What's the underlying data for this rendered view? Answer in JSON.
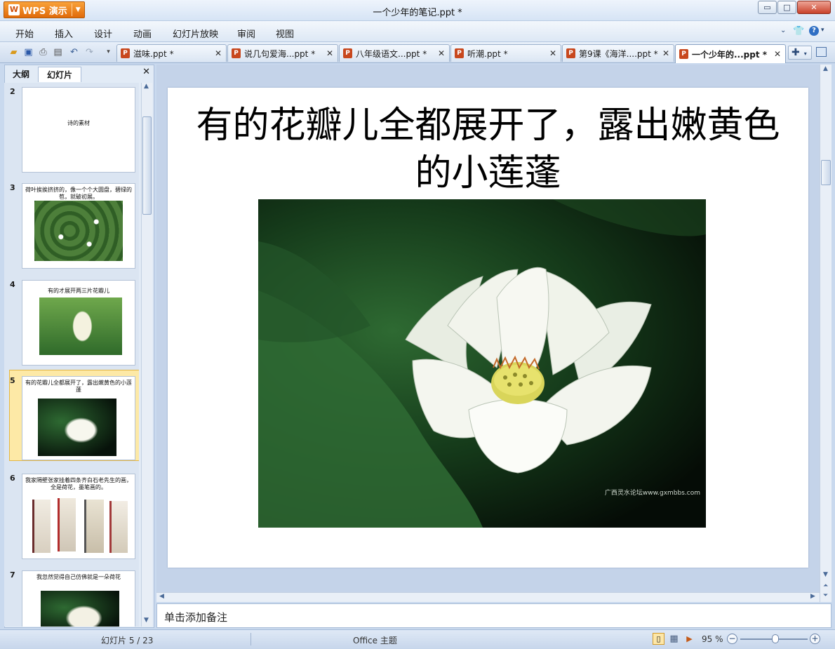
{
  "app": {
    "name": "WPS 演示",
    "window_title": "一个少年的笔记.ppt *"
  },
  "window_controls": {
    "minimize": "▭",
    "maximize": "□",
    "close": "✕"
  },
  "menu": [
    "开始",
    "插入",
    "设计",
    "动画",
    "幻灯片放映",
    "审阅",
    "视图"
  ],
  "doc_tabs": [
    {
      "label": "滋味.ppt *",
      "active": false
    },
    {
      "label": "说几句爱海...ppt *",
      "active": false
    },
    {
      "label": "八年级语文...ppt *",
      "active": false
    },
    {
      "label": "听潮.ppt *",
      "active": false
    },
    {
      "label": "第9课《海洋....ppt *",
      "active": false
    },
    {
      "label": "一个少年的...ppt *",
      "active": true
    }
  ],
  "left_panel": {
    "tabs": [
      "大纲",
      "幻灯片"
    ],
    "active_tab": "幻灯片"
  },
  "thumbnails": [
    {
      "num": "2",
      "text": "诗的素材"
    },
    {
      "num": "3",
      "text": "荷叶挨挨挤挤的，像一个个大圆盘，碧绿的苞，就破初展。"
    },
    {
      "num": "4",
      "text": "有的才展开两三片花瓣儿"
    },
    {
      "num": "5",
      "text": "有的花瓣儿全都展开了，露出嫩黄色的小莲蓬"
    },
    {
      "num": "6",
      "text": "我家隔壁张家挂着四条齐白石老先生的画，全是荷花，墨笔画的。"
    },
    {
      "num": "7",
      "text": "我忽然觉得自己仿佛就是一朵荷花"
    }
  ],
  "slide": {
    "title": "有的花瓣儿全都展开了，露出嫩黄色的小莲蓬",
    "watermark": "广西灵水论坛www.gxmbbs.com"
  },
  "notes_placeholder": "单击添加备注",
  "status": {
    "slide_pos": "幻灯片 5 / 23",
    "theme": "Office 主题",
    "zoom": "95 %",
    "zoom_fraction": 0.52
  },
  "colors": {
    "accent": "#e8770f",
    "selection": "#fde9a6",
    "chrome": "#c9d9ee"
  }
}
